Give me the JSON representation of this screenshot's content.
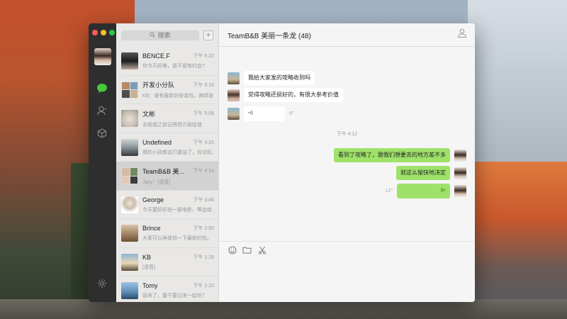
{
  "app": {
    "search_placeholder": "搜索",
    "add_label": "+"
  },
  "conversations": [
    {
      "name": "BENCE.F",
      "time": "下午 5:22",
      "preview": "你今天好美，是不是有约会?"
    },
    {
      "name": "开发小分队",
      "time": "下午 5:16",
      "preview": "KB：谁有最新的安装包，麻烦发..."
    },
    {
      "name": "文彬",
      "time": "下午 5:08",
      "preview": "去吸烟之前记得把方案给我"
    },
    {
      "name": "Undefined",
      "time": "下午 4:25",
      "preview": "我的小孩都会打酱油了，你没机..."
    },
    {
      "name": "TeamB&B 美...",
      "time": "下午 4:14",
      "preview": "Jacy：[语音]"
    },
    {
      "name": "George",
      "time": "下午 3:46",
      "preview": "今天要好好拍一部电影，等会给..."
    },
    {
      "name": "Brince",
      "time": "下午 2:50",
      "preview": "大家可以再体验一下最新的包。"
    },
    {
      "name": "KB",
      "time": "下午 1:28",
      "preview": "[语音]"
    },
    {
      "name": "Tomy",
      "time": "下午 1:20",
      "preview": "饭来了，要不要过来一起吃？"
    }
  ],
  "chat": {
    "title": "TeamB&B 美丽一条龙 (48)",
    "time_separator": "下午 4:12",
    "incoming": [
      {
        "text": "我给大家发的攻略收到吗"
      },
      {
        "text": "觉得攻略还挺好的，有很大参考价值"
      },
      {
        "voice_duration": "8''"
      }
    ],
    "outgoing": [
      {
        "text": "看到了攻略了，跟我们想要去的地方差不多"
      },
      {
        "text": "就这么愉快地决定"
      },
      {
        "voice_duration": "12''"
      }
    ]
  },
  "colors": {
    "sidebar_bg": "#2e2e2e",
    "accent_green": "#46c93a",
    "bubble_out": "#9fe26a",
    "list_bg": "#e9e8e7",
    "selected_bg": "#d2d2d2"
  },
  "icons": [
    "chat-icon",
    "contacts-icon",
    "favorites-icon",
    "settings-icon",
    "search-icon",
    "group-members-icon",
    "emoji-icon",
    "folder-icon",
    "scissors-icon",
    "voice-icon"
  ]
}
